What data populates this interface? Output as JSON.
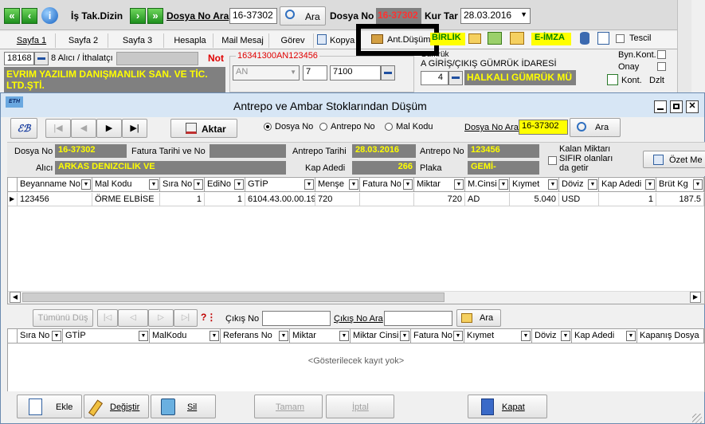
{
  "toolbar": {
    "is_takip_dizin": "İş Tak.Dizin",
    "dosya_no_ara_label": "Dosya No Ara",
    "dosya_no_ara_value": "16-37302",
    "ara_label": "Ara",
    "dosya_no_label": "Dosya No",
    "dosya_no_value": "16-37302",
    "kur_tar_label": "Kur Tar",
    "kur_tar_value": "28.03.2016"
  },
  "tabs": [
    {
      "label": "Sayfa 1"
    },
    {
      "label": "Sayfa 2"
    },
    {
      "label": "Sayfa 3"
    },
    {
      "label": "Hesapla"
    },
    {
      "label": "Mail Mesaj"
    },
    {
      "label": "Görev"
    },
    {
      "label": "Kopya"
    },
    {
      "label": "Ant.Düşüm"
    }
  ],
  "right_toolbar": {
    "birlik": "BİRLİK",
    "e_imza": "E-İMZA",
    "tescil": "Tescil",
    "byn_kont": "Byn.Kont.",
    "onay": "Onay",
    "kont": "Kont.",
    "dzlt": "Dzlt"
  },
  "bg_form": {
    "alici_code": "18168",
    "alici_label": "8 Alıcı / İthalatçı",
    "not_label": "Not",
    "ref_text": "16341300AN123456",
    "company": "EVRIM YAZILIM DANIŞMANLIK SAN. VE TİC. LTD.ŞTİ.",
    "an_value": "AN",
    "seven": "7",
    "seven_one": "7100",
    "gumruk_label": "Gümrük",
    "gumruk_idaresi": "A GİRİŞ/ÇIKIŞ GÜMRÜK İDARESİ",
    "gumruk_no": "4",
    "gumruk_name": "HALKALI GÜMRÜK MÜ"
  },
  "dialog": {
    "title": "Antrepo ve Ambar Stoklarından Düşüm",
    "aktar": "Aktar",
    "radio_dosya": "Dosya No",
    "radio_antrepo": "Antrepo No",
    "radio_mal": "Mal Kodu",
    "dosya_no_ara_label": "Dosya No Ara",
    "dosya_no_ara_value": "16-37302",
    "ara": "Ara",
    "info": {
      "dosya_no_label": "Dosya No",
      "dosya_no": "16-37302",
      "fatura_label": "Fatura Tarihi ve No",
      "fatura_value": "",
      "antrepo_tarihi_label": "Antrepo Tarihi",
      "antrepo_tarihi": "28.03.2016",
      "antrepo_no_label": "Antrepo No",
      "antrepo_no": "123456",
      "kalan_label": "Kalan Miktarı SIFIR olanları da getir",
      "alici_label": "Alıcı",
      "alici": "ARKAS DENIZCILIK VE",
      "kap_adedi_label": "Kap Adedi",
      "kap_adedi": "266",
      "plaka_label": "Plaka",
      "plaka": "GEMİ-",
      "ozet_label": "Özet Me"
    },
    "grid1_headers": [
      "Beyanname No",
      "Mal Kodu",
      "Sıra No",
      "EdiNo",
      "GTİP",
      "Menşe",
      "Fatura No",
      "Miktar",
      "M.Cinsi",
      "Kıymet",
      "Döviz",
      "Kap Adedi",
      "Brüt Kg"
    ],
    "grid1_rows": [
      [
        "123456",
        "ÖRME ELBİSE",
        "1",
        "1",
        "6104.43.00.00.19",
        "720",
        "",
        "720",
        "AD",
        "5.040",
        "USD",
        "1",
        "187.5"
      ]
    ],
    "tumunu_dus": "Tümünü Düş",
    "cikis_no_label": "Çıkış No",
    "cikis_no_ara_label": "Çıkış No Ara",
    "ara2": "Ara",
    "grid2_headers": [
      "Sıra No",
      "GTİP",
      "MalKodu",
      "Referans No",
      "Miktar",
      "Miktar Cinsi",
      "Fatura No",
      "Kıymet",
      "Döviz",
      "Kap Adedi",
      "Kapanış Dosya"
    ],
    "empty_text": "<Gösterilecek kayıt yok>",
    "buttons": {
      "ekle": "Ekle",
      "degistir": "Değiştir",
      "sil": "Sil",
      "tamam": "Tamam",
      "iptal": "İptal",
      "kapat": "Kapat"
    }
  },
  "colors": {
    "highlight_box": "#000000",
    "yellow_text": "#ffff00",
    "red_text": "#ff0000",
    "dark_field": "#808080"
  }
}
